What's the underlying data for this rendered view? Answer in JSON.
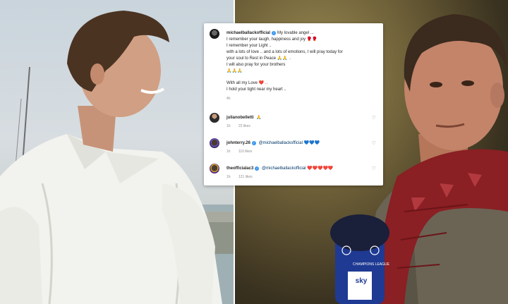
{
  "post": {
    "username": "michaelballackofficial",
    "lines": [
      "My lovable angel ...",
      "I remember your laugh, happiness and joy ",
      "I remember your Light ..",
      "with a lots of love .. and a lots of emotions, I will pray today for",
      "your soul to Rest in Peace ",
      "I will also pray for your brothers",
      "",
      "With all my Love ",
      "I hold your tight near my heart .."
    ],
    "emoji_line2": "🥊🥊",
    "emoji_line5": "🙏🙏 ..",
    "emoji_line6": "🙏🙏🙏",
    "emoji_line8": "❤️ ..",
    "time": "4h"
  },
  "comments": [
    {
      "username": "julianobelletti",
      "text": "",
      "emojis": "🙏",
      "time": "1h",
      "likes": "22 likes"
    },
    {
      "username": "johnterry.26",
      "text": "@michaelballackofficial",
      "emojis": "💙💙💙",
      "time": "1h",
      "likes": "110 likes"
    },
    {
      "username": "theofficialac3",
      "text": "@michaelballackofficial",
      "emojis": "❤️❤️❤️❤️❤️",
      "time": "1h",
      "likes": "121 likes"
    }
  ],
  "microphone": {
    "brand": "CHAMPIONS LEAGUE",
    "broadcaster": "sky"
  },
  "colors": {
    "verified": "#3897f0",
    "mention": "#00376b",
    "scarf": "#8a1f24",
    "mic_blue": "#1f3a93"
  }
}
